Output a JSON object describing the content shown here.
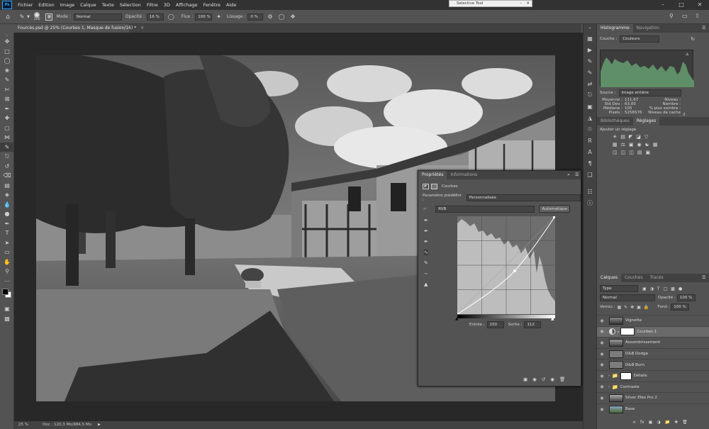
{
  "menu": [
    "Fichier",
    "Edition",
    "Image",
    "Calque",
    "Texte",
    "Sélection",
    "Filtre",
    "3D",
    "Affichage",
    "Fenêtre",
    "Aide"
  ],
  "ps_logo": "Ps",
  "selective_tool": {
    "title": "Selective Tool"
  },
  "options": {
    "brush_size": "200",
    "mode_label": "Mode :",
    "mode_value": "Normal",
    "opacity_label": "Opacité :",
    "opacity_value": "16 %",
    "flow_label": "Flux :",
    "flow_value": "100 %",
    "smoothing_label": "Lissage :",
    "smoothing_value": "0 %"
  },
  "doc_tab": {
    "title": "Fourcès.psd @ 25% (Courbes 1, Masque de fusion/16) *"
  },
  "status": {
    "zoom": "25 %",
    "doc": "Doc : 120,3 Mo/984,5 Mo"
  },
  "histogram": {
    "tabs": [
      "Histogramme",
      "Navigation"
    ],
    "channel_label": "Couche :",
    "channel_value": "Couleurs",
    "source_label": "Source :",
    "source_value": "Image entière",
    "stats_left": [
      [
        "Moyenne :",
        "111,67"
      ],
      [
        "Std Dev :",
        "63,00"
      ],
      [
        "Médiane :",
        "105"
      ],
      [
        "Pixels :",
        "5256576"
      ]
    ],
    "stats_right": [
      [
        "Niveau :",
        ""
      ],
      [
        "Nombre :",
        ""
      ],
      [
        "% plus sombre :",
        ""
      ],
      [
        "Niveau de cache :",
        "2"
      ]
    ],
    "fill_color": "#5f8f68"
  },
  "adjustments": {
    "tabs": [
      "Bibliothèques",
      "Réglages"
    ],
    "add_label": "Ajouter un réglage"
  },
  "properties": {
    "tabs": [
      "Propriétés",
      "Informations"
    ],
    "curves_label": "Courbes",
    "preset_label": "Paramètre prédéfini :",
    "preset_value": "Personnalisée",
    "channel_value": "RVB",
    "auto_button": "Automatique",
    "input_label": "Entrée :",
    "input_value": "150",
    "output_label": "Sortie :",
    "output_value": "112"
  },
  "layers": {
    "tabs": [
      "Calques",
      "Couches",
      "Tracés"
    ],
    "filter_value": "Type",
    "blend_value": "Normal",
    "opacity_label": "Opacité :",
    "opacity_value": "100 %",
    "lock_label": "Verrou :",
    "fill_label": "Fond :",
    "fill_value": "100 %",
    "items": [
      {
        "name": "Vignette",
        "type": "img"
      },
      {
        "name": "Courbes 1",
        "type": "adj"
      },
      {
        "name": "Assombrissement",
        "type": "img"
      },
      {
        "name": "D&B Dodge",
        "type": "gray"
      },
      {
        "name": "D&B Burn",
        "type": "gray"
      },
      {
        "name": "Détails",
        "type": "group"
      },
      {
        "name": "Contraste",
        "type": "group"
      },
      {
        "name": "Silver Efex Pro 2",
        "type": "img"
      },
      {
        "name": "Base",
        "type": "color"
      }
    ]
  }
}
